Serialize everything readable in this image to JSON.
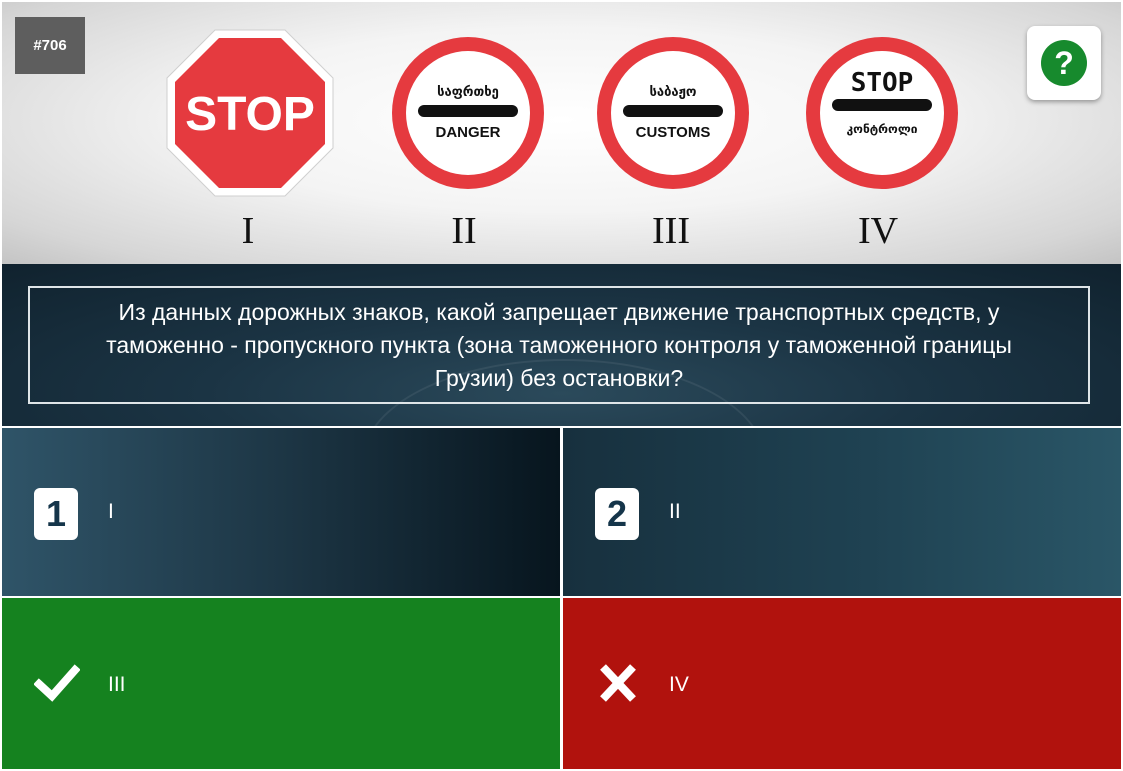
{
  "question_id": "#706",
  "help_icon": "question-mark-icon",
  "signs": [
    {
      "numeral": "I",
      "type": "stop-octagon",
      "text": "STOP"
    },
    {
      "numeral": "II",
      "type": "barrier-circle",
      "top_text": "საფრთხე",
      "bottom_text": "DANGER"
    },
    {
      "numeral": "III",
      "type": "barrier-circle",
      "top_text": "საბაჟო",
      "bottom_text": "CUSTOMS"
    },
    {
      "numeral": "IV",
      "type": "barrier-circle",
      "top_text": "STOP",
      "bottom_text": "კონტროლი"
    }
  ],
  "question": "Из данных дорожных знаков, какой запрещает движение транспортных средств, у таможенно - пропускного пункта (зона таможенного контроля у таможенной границы Грузии) без остановки?",
  "answers": [
    {
      "badge": "1",
      "label": "I",
      "state": "neutral"
    },
    {
      "badge": "2",
      "label": "II",
      "state": "neutral"
    },
    {
      "badge": "",
      "label": "III",
      "state": "correct",
      "icon": "check-icon"
    },
    {
      "badge": "",
      "label": "IV",
      "state": "wrong",
      "icon": "cross-icon"
    }
  ],
  "colors": {
    "correct": "#15821f",
    "wrong": "#b1120d",
    "sign_red": "#e53a3f",
    "help_green": "#178a2d"
  }
}
